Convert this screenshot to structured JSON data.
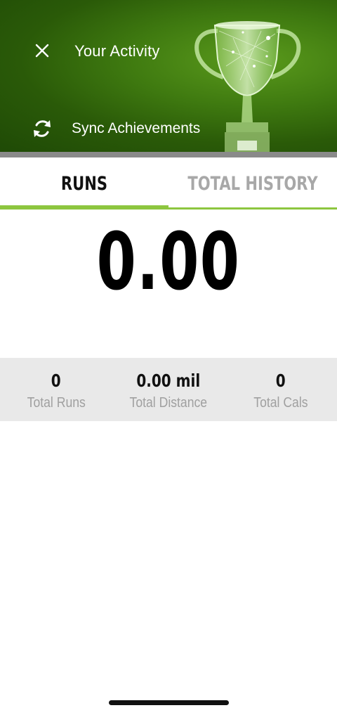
{
  "header": {
    "title": "Your Activity",
    "sync_label": "Sync Achievements",
    "close_icon": "close-icon",
    "sync_icon": "sync-icon",
    "banner_image": "trophy-icon"
  },
  "tabs": [
    {
      "label": "RUNS",
      "active": true
    },
    {
      "label": "TOTAL HISTORY",
      "active": false
    }
  ],
  "main": {
    "big_value": "0.00"
  },
  "stats": [
    {
      "value": "0",
      "label": "Total Runs"
    },
    {
      "value": "0.00 mil",
      "label": "Total Distance"
    },
    {
      "value": "0",
      "label": "Total Cals"
    }
  ],
  "colors": {
    "banner_green": "#3f7a10",
    "accent_green": "#8dc63f",
    "inactive_tab": "#a8a8a8",
    "stats_background": "#e9e9e9"
  }
}
